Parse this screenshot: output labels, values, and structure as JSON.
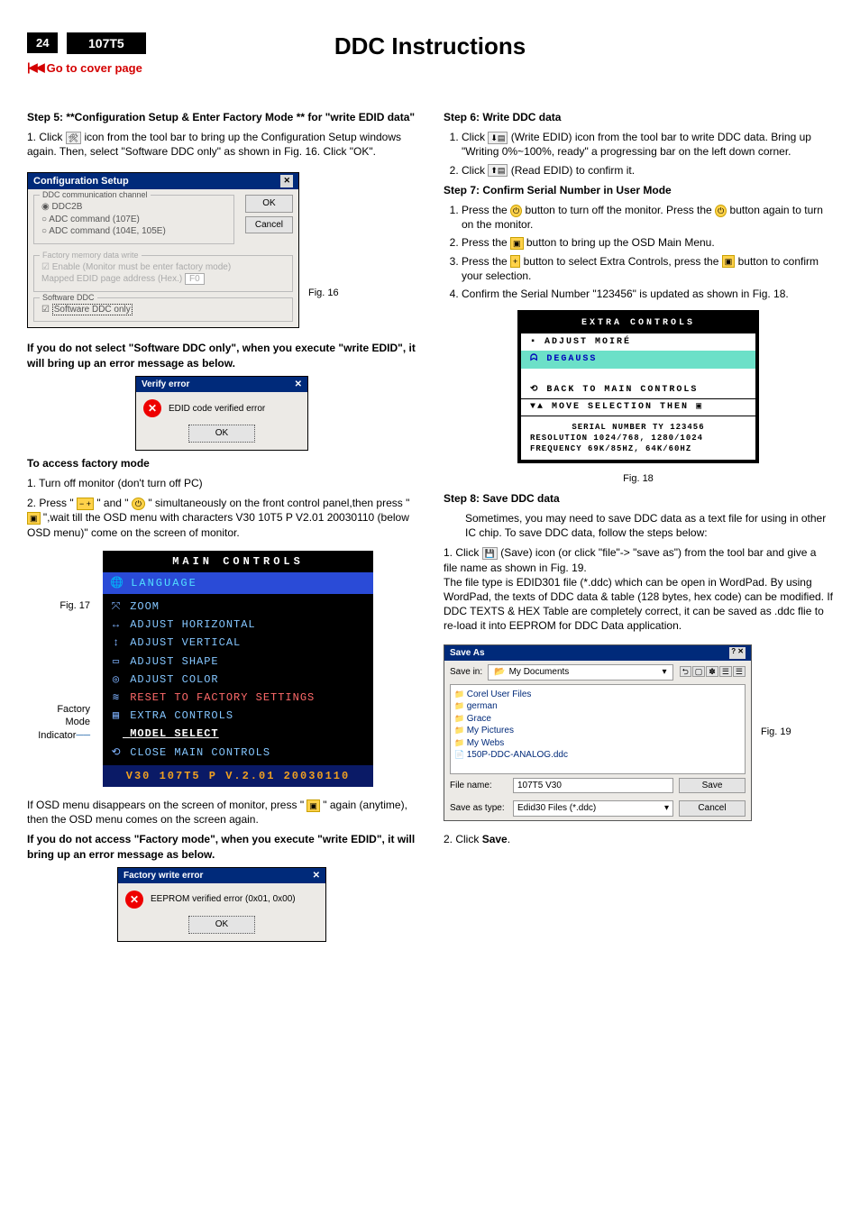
{
  "header": {
    "page_number": "24",
    "model": "107T5",
    "title": "DDC Instructions",
    "cover_link": "Go to cover page"
  },
  "left": {
    "step5_title": "Step 5: **Configuration Setup & Enter Factory Mode ** for \"write EDID data\"",
    "step5_item1_pre": "1.    Click ",
    "step5_item1_post": " icon from the tool bar to bring up the Configuration Setup windows again. Then, select \"Software DDC only\" as shown in Fig. 16. Click \"OK\".",
    "fig16_label": "Fig. 16",
    "cfg": {
      "title": "Configuration Setup",
      "grp1": "DDC communication channel",
      "opt_ddc2b": "DDC2B",
      "opt_adc107": "ADC command (107E)",
      "opt_adc104": "ADC command (104E, 105E)",
      "grp2": "Factory memory data write",
      "enable": "Enable (Monitor must be enter factory mode)",
      "mapped": "Mapped EDID page address (Hex.)",
      "mapped_val": "F0",
      "grp3": "Software DDC",
      "chk_sw": "Software DDC only",
      "ok": "OK",
      "cancel": "Cancel"
    },
    "no_sw_ddc": "If you do not select \"Software DDC only\", when you execute \"write EDID\", it will bring up an error message as below.",
    "verify": {
      "title": "Verify error",
      "msg": "EDID code verified error",
      "ok": "OK"
    },
    "access_title": "To access factory mode",
    "access_1": "1. Turn off monitor (don't turn off PC)",
    "access_2a": "2. Press \" ",
    "access_2b": " \" and \" ",
    "access_2c": " \" simultaneously on the front control panel,then press \" ",
    "access_2d": " \",wait till the OSD menu with characters V30 10T5 P V2.01  20030110 (below OSD menu)\" come on the screen of monitor.",
    "fig17_label": "Fig. 17",
    "fig17_side1": "Factory",
    "fig17_side2": "Mode",
    "fig17_side3": "Indicator",
    "osd": {
      "hdr": "MAIN CONTROLS",
      "lang": "LANGUAGE",
      "rows": [
        "ZOOM",
        "ADJUST HORIZONTAL",
        "ADJUST VERTICAL",
        "ADJUST SHAPE",
        "ADJUST COLOR",
        "RESET TO FACTORY SETTINGS",
        "EXTRA CONTROLS",
        "MODEL SELECT",
        "CLOSE MAIN CONTROLS"
      ],
      "footer": "V30  107T5 P V.2.01  20030110"
    },
    "osd_disappear_a": "If OSD menu disappears on the screen of monitor, press \" ",
    "osd_disappear_b": " \" again (anytime), then the OSD menu comes on the screen again.",
    "no_factory": "If you do not access \"Factory mode\", when you execute \"write EDID\", it will bring up an error message as below.",
    "factory_err": {
      "title": "Factory write error",
      "msg": "EEPROM verified error (0x01, 0x00)",
      "ok": "OK"
    }
  },
  "right": {
    "step6_title": "Step 6: Write DDC data",
    "step6_1a": "Click ",
    "step6_1b": " (Write EDID) icon from the tool bar to write DDC data. Bring up \"Writing 0%~100%, ready\" a progressing bar on the left down corner.",
    "step6_2a": "Click ",
    "step6_2b": " (Read EDID) to confirm it.",
    "step7_title": "Step 7: Confirm Serial Number in User Mode",
    "step7_1a": "Press the ",
    "step7_1b": " button to turn off the monitor. Press the ",
    "step7_1c": " button again to turn on the monitor.",
    "step7_2a": "Press the ",
    "step7_2b": " button to bring up the OSD Main Menu.",
    "step7_3a": "Press the ",
    "step7_3b": " button to select Extra Controls, press the ",
    "step7_3c": " button to confirm your selection.",
    "step7_4": "Confirm the Serial Number \"123456\" is updated as shown in Fig. 18.",
    "osd2": {
      "hdr": "EXTRA CONTROLS",
      "row1": "ADJUST MOIRÉ",
      "row2": "DEGAUSS",
      "row3": "BACK TO MAIN CONTROLS",
      "hint_a": "MOVE SELECTION THEN",
      "info1": "SERIAL NUMBER TY 123456",
      "info2": "RESOLUTION 1024/768, 1280/1024",
      "info3": "FREQUENCY 69K/85HZ, 64K/60HZ"
    },
    "fig18_label": "Fig. 18",
    "step8_title": "Step 8: Save DDC data",
    "step8_intro": "Sometimes, you may need to save DDC data as a text file for using in other IC chip. To save DDC data, follow the steps below:",
    "step8_1a": "Click ",
    "step8_1b": " (Save) icon (or click \"file\"-> \"save as\") from the tool bar and give a file name as shown in Fig. 19.",
    "step8_1c": "The file type is EDID301 file (*.ddc) which can be open in WordPad. By using WordPad, the texts of DDC data & table (128 bytes, hex code) can be modified. If DDC TEXTS & HEX Table are completely correct, it can be saved as .ddc flie to re-load it into EEPROM for DDC Data application.",
    "saveas": {
      "title": "Save As",
      "savein_lbl": "Save in:",
      "savein_val": "My Documents",
      "folders": [
        "Corel User Files",
        "german",
        "Grace",
        "My Pictures",
        "My Webs"
      ],
      "file": "150P-DDC-ANALOG.ddc",
      "fn_lbl": "File name:",
      "fn_val": "107T5 V30",
      "type_lbl": "Save as type:",
      "type_val": "Edid30 Files (*.ddc)",
      "save": "Save",
      "cancel": "Cancel"
    },
    "fig19_label": "Fig. 19",
    "step8_2_pre": "2.    Click ",
    "step8_2_bold": "Save",
    "step8_2_post": "."
  }
}
